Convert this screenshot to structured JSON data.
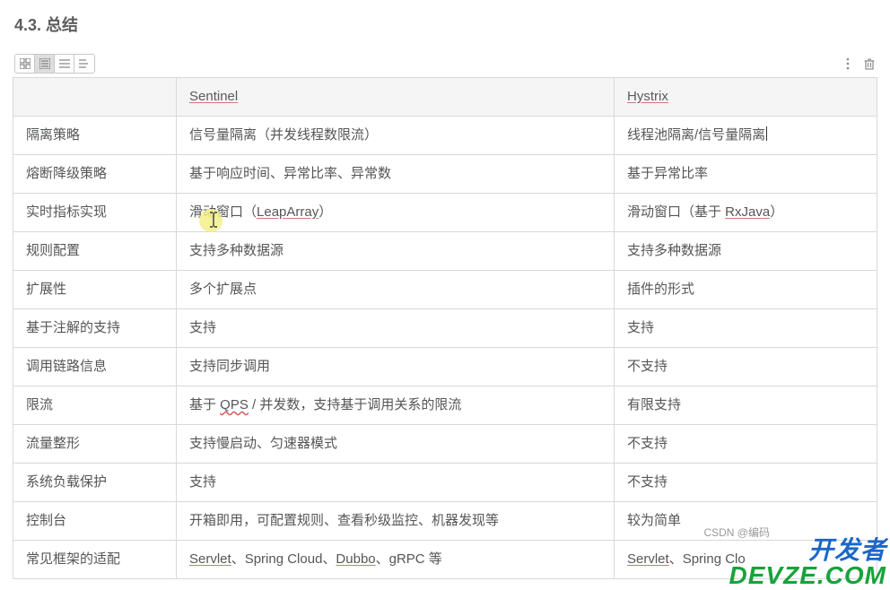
{
  "heading": "4.3. 总结",
  "table": {
    "headers": {
      "blank": "",
      "col1": "Sentinel",
      "col2": "Hystrix"
    },
    "rows": [
      {
        "label": "隔离策略",
        "c1_plain": "信号量隔离（并发线程数限流）",
        "c2_a": "线程池隔离/信号量隔离"
      },
      {
        "label": "熔断降级策略",
        "c1_plain": "基于响应时间、异常比率、异常数",
        "c2_a": "基于异常比率"
      },
      {
        "label": "实时指标实现",
        "c1_a": "滑动窗口（",
        "c1_u": "LeapArray",
        "c1_b": "）",
        "c2_a": "滑动窗口（基于 ",
        "c2_u": "RxJava",
        "c2_b": "）"
      },
      {
        "label": "规则配置",
        "c1_plain": "支持多种数据源",
        "c2_a": "支持多种数据源"
      },
      {
        "label": "扩展性",
        "c1_plain": "多个扩展点",
        "c2_a": "插件的形式"
      },
      {
        "label": "基于注解的支持",
        "c1_plain": "支持",
        "c2_a": "支持"
      },
      {
        "label": "调用链路信息",
        "c1_plain": "支持同步调用",
        "c2_a": "不支持"
      },
      {
        "label": "限流",
        "c1_a": "基于 ",
        "c1_u": "QPS",
        "c1_b": " / 并发数，支持基于调用关系的限流",
        "c2_a": "有限支持"
      },
      {
        "label": "流量整形",
        "c1_plain": "支持慢启动、匀速器模式",
        "c2_a": "不支持"
      },
      {
        "label": "系统负载保护",
        "c1_plain": "支持",
        "c2_a": "不支持"
      },
      {
        "label": "控制台",
        "c1_plain": "开箱即用，可配置规则、查看秒级监控、机器发现等",
        "c2_a": "较为简单"
      },
      {
        "label": "常见框架的适配",
        "c1_a": "",
        "c1_u": "Servlet",
        "c1_b": "、Spring Cloud、",
        "c1_u2": "Dubbo",
        "c1_c": "、gRPC 等",
        "c2_u": "Servlet",
        "c2_b": "、Spring Clo"
      }
    ]
  },
  "watermark": {
    "brand_a": "开发者",
    "brand_b": "DEVZE.COM",
    "small": "CSDN @编码"
  }
}
